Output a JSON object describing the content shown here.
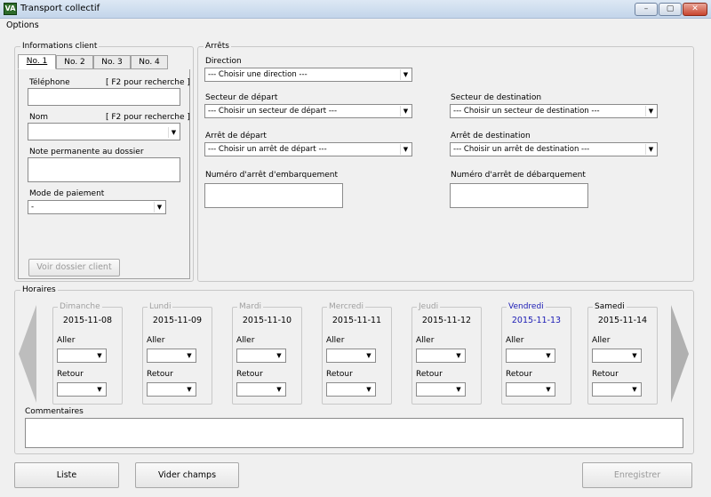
{
  "window": {
    "title": "Transport collectif",
    "controls": [
      "–",
      "▢",
      "✕"
    ]
  },
  "menu": {
    "options": "Options"
  },
  "client": {
    "legend": "Informations client",
    "tabs": [
      "No. 1",
      "No. 2",
      "No. 3",
      "No. 4"
    ],
    "phone_label": "Téléphone",
    "phone_hint": "[ F2 pour recherche ]",
    "phone_value": "",
    "name_label": "Nom",
    "name_hint": "[ F2 pour recherche ]",
    "name_value": "",
    "note_label": "Note permanente au dossier",
    "note_value": "",
    "payment_label": "Mode de paiement",
    "payment_value": "-",
    "dossier_button": "Voir dossier client"
  },
  "stops": {
    "legend": "Arrêts",
    "direction_label": "Direction",
    "direction_value": "--- Choisir une direction ---",
    "dep_sector_label": "Secteur de départ",
    "dep_sector_value": "--- Choisir un secteur de départ ---",
    "dest_sector_label": "Secteur de destination",
    "dest_sector_value": "--- Choisir un secteur de destination ---",
    "dep_stop_label": "Arrêt de départ",
    "dep_stop_value": "--- Choisir un arrêt de départ ---",
    "dest_stop_label": "Arrêt de destination",
    "dest_stop_value": "--- Choisir un arrêt de destination ---",
    "board_label": "Numéro d'arrêt d'embarquement",
    "board_value": "",
    "alight_label": "Numéro d'arrêt de débarquement",
    "alight_value": ""
  },
  "schedule": {
    "legend": "Horaires",
    "aller": "Aller",
    "retour": "Retour",
    "days": [
      {
        "name": "Dimanche",
        "date": "2015-11-08",
        "state": "disabled"
      },
      {
        "name": "Lundi",
        "date": "2015-11-09",
        "state": "disabled"
      },
      {
        "name": "Mardi",
        "date": "2015-11-10",
        "state": "disabled"
      },
      {
        "name": "Mercredi",
        "date": "2015-11-11",
        "state": "disabled"
      },
      {
        "name": "Jeudi",
        "date": "2015-11-12",
        "state": "disabled"
      },
      {
        "name": "Vendredi",
        "date": "2015-11-13",
        "state": "current"
      },
      {
        "name": "Samedi",
        "date": "2015-11-14",
        "state": "normal"
      }
    ],
    "comments_label": "Commentaires",
    "comments_value": ""
  },
  "footer": {
    "list_button": "Liste",
    "clear_button": "Vider champs",
    "save_button": "Enregistrer"
  },
  "colors": {
    "current_day": "#1b1bb5",
    "disabled": "#a0a0a0"
  }
}
